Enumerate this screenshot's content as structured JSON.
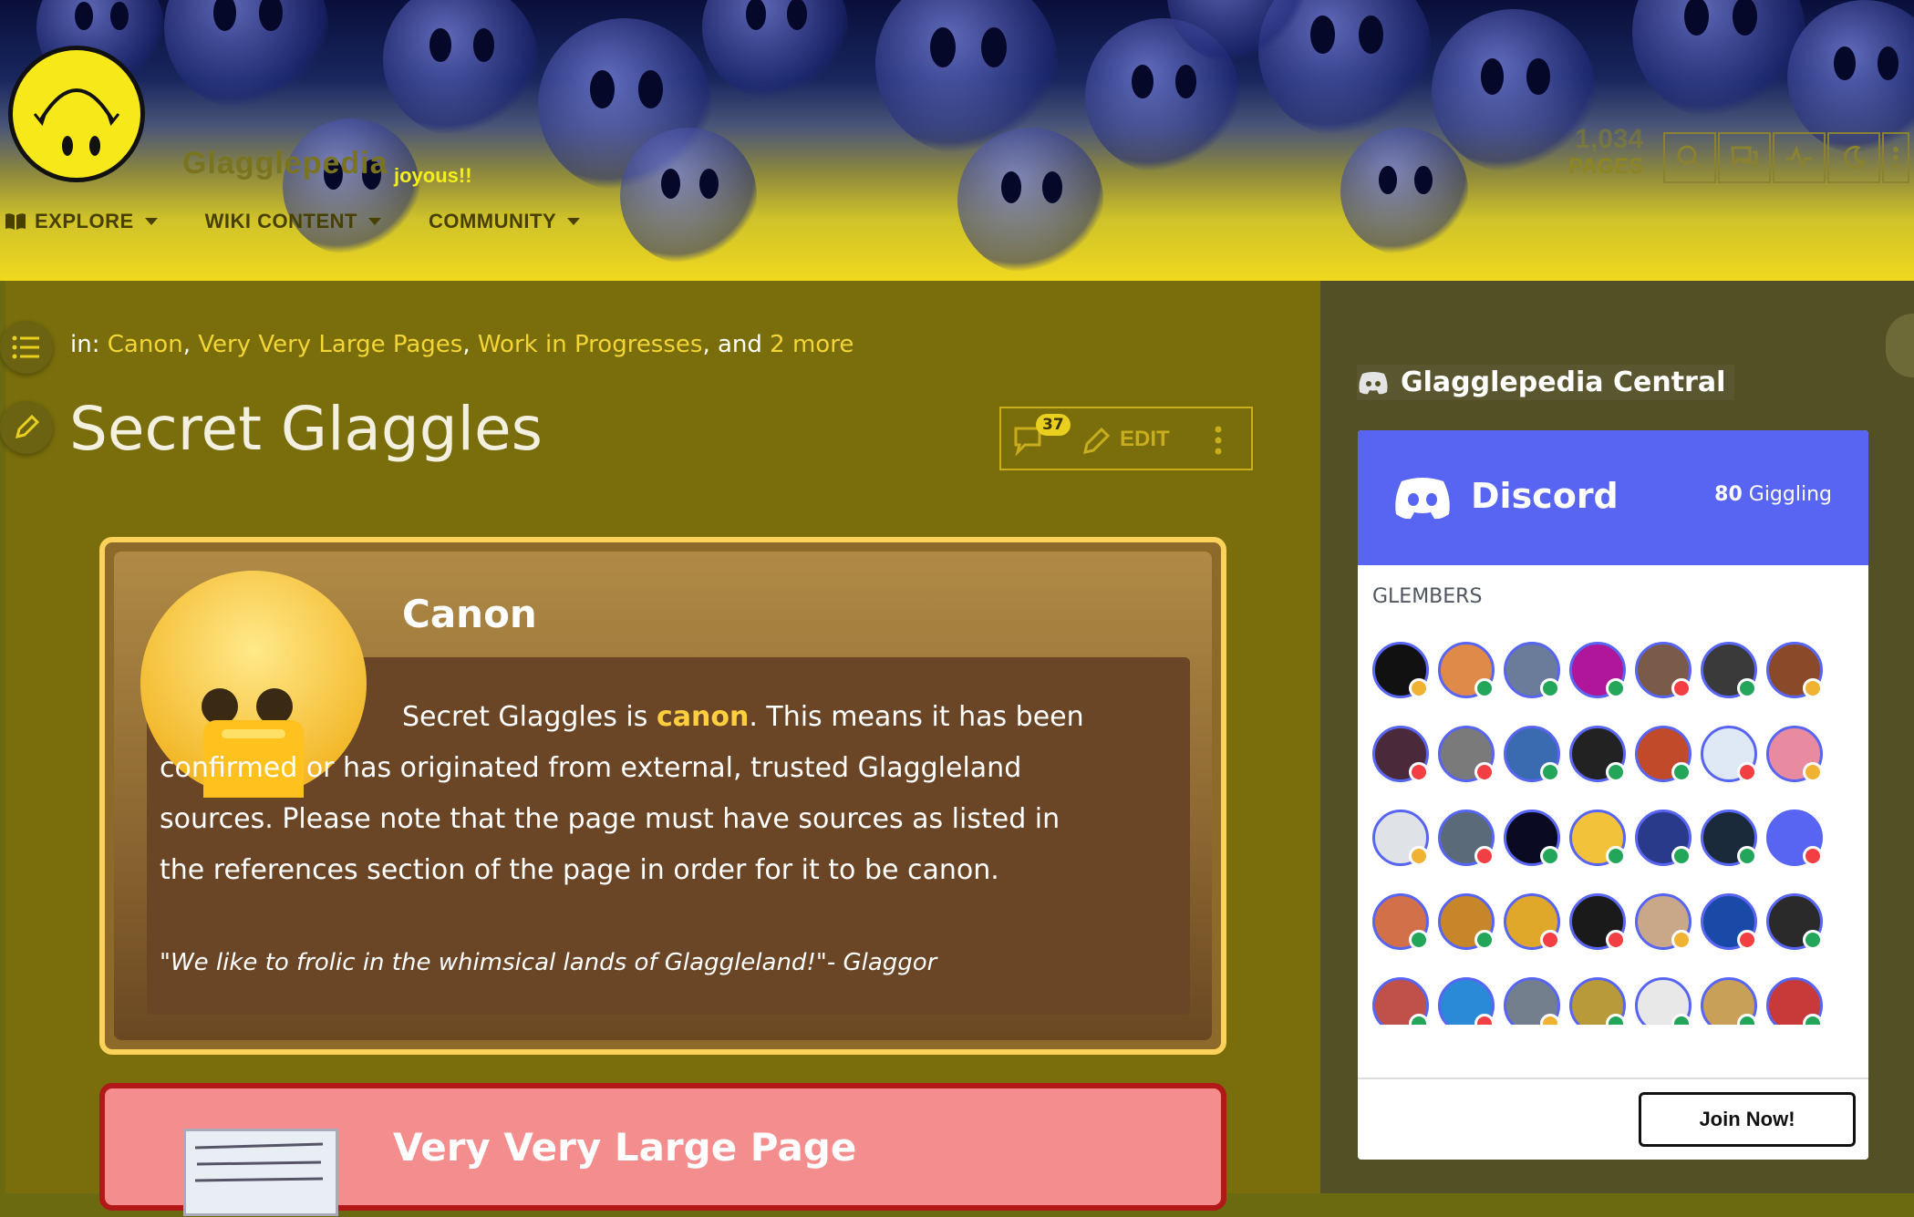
{
  "header": {
    "site_title": "Glagglepedia",
    "site_tagline": "joyous!!",
    "pages_count_number": "1,034",
    "pages_count_label": "PAGES",
    "nav": [
      {
        "label": "EXPLORE",
        "icon": "book-icon"
      },
      {
        "label": "WIKI CONTENT"
      },
      {
        "label": "COMMUNITY"
      }
    ],
    "tools": [
      "search-icon",
      "discussions-icon",
      "activity-icon",
      "dark-mode-icon",
      "more-icon"
    ]
  },
  "breadcrumb": {
    "prefix": "in:",
    "categories": [
      "Canon",
      "Very Very Large Pages",
      "Work in Progresses"
    ],
    "conjunction": "and",
    "more": "2 more"
  },
  "article": {
    "title": "Secret Glaggles",
    "comment_count": "37",
    "edit_label": "EDIT"
  },
  "canon_box": {
    "heading": "Canon",
    "text_before": "Secret Glaggles is",
    "text_highlight": "canon",
    "text_after": ". This means it has been confirmed or has originated from external, trusted Glaggleland sources. Please note that the page must have sources as listed in the references section of the page in order for it to be canon.",
    "quote": "\"We like to frolic in the whimsical lands of Glaggleland!\"- Glaggor"
  },
  "vvlp_box": {
    "heading": "Very Very Large Page"
  },
  "sidebar": {
    "central_title": "Glagglepedia Central",
    "discord": {
      "brand": "Discord",
      "online_count": "80",
      "online_label": "Giggling",
      "members_label": "GLEMBERS",
      "join_label": "Join Now!"
    }
  },
  "colors": {
    "accent_yellow": "#f3d535",
    "discord_blurple": "#5865f2",
    "canon_border": "#fcd25a",
    "vvlp_border": "#b21818"
  }
}
